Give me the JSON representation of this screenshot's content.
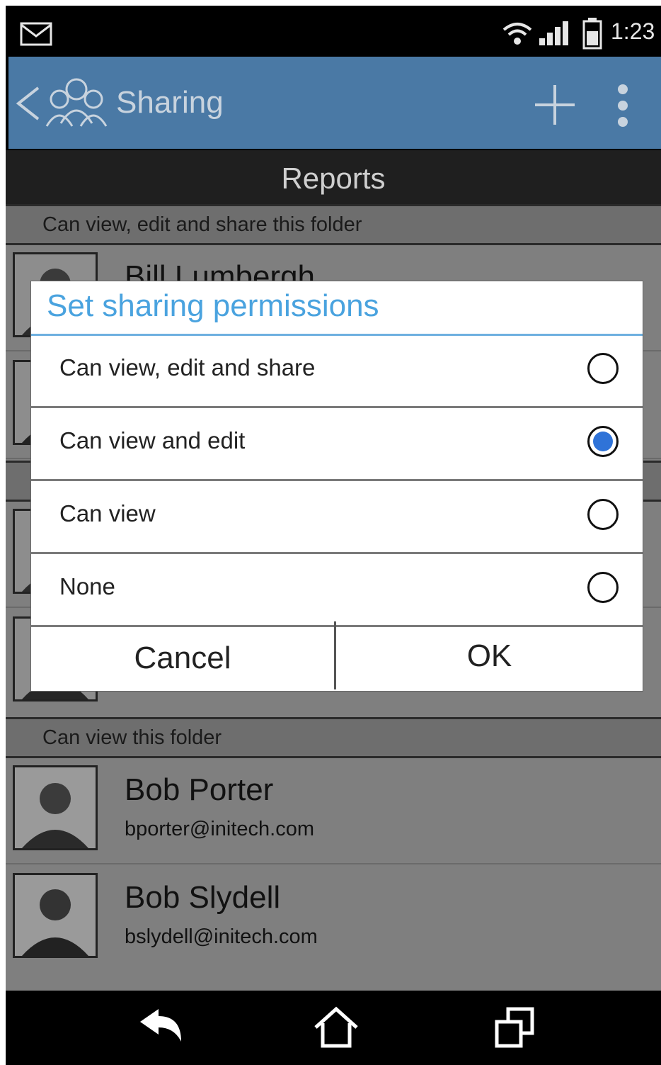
{
  "status_bar": {
    "time": "1:23",
    "icons": [
      "mail-icon",
      "wifi-icon",
      "signal-icon",
      "battery-icon"
    ]
  },
  "action_bar": {
    "title": "Sharing",
    "icons": [
      "back-icon",
      "people-icon",
      "add-icon",
      "overflow-menu-icon"
    ],
    "color": "#4a79a5"
  },
  "folder": {
    "name": "Reports"
  },
  "sections": [
    {
      "header": "Can view, edit and share this folder",
      "people": [
        {
          "name": "Bill Lumbergh"
        }
      ]
    },
    {
      "header": "Can view this folder",
      "people": [
        {
          "name": "Bob Porter",
          "email": "bporter@initech.com"
        },
        {
          "name": "Bob Slydell",
          "email": "bslydell@initech.com"
        }
      ]
    }
  ],
  "dialog": {
    "title": "Set sharing permissions",
    "options": [
      {
        "label": "Can view, edit and share",
        "selected": false
      },
      {
        "label": "Can view and edit",
        "selected": true
      },
      {
        "label": "Can view",
        "selected": false
      },
      {
        "label": "None",
        "selected": false
      }
    ],
    "cancel_label": "Cancel",
    "ok_label": "OK",
    "accent_color": "#4aa3df",
    "radio_selected_color": "#2f73d8"
  },
  "nav_bar": {
    "icons": [
      "back-arrow-icon",
      "home-icon",
      "recent-apps-icon"
    ]
  }
}
